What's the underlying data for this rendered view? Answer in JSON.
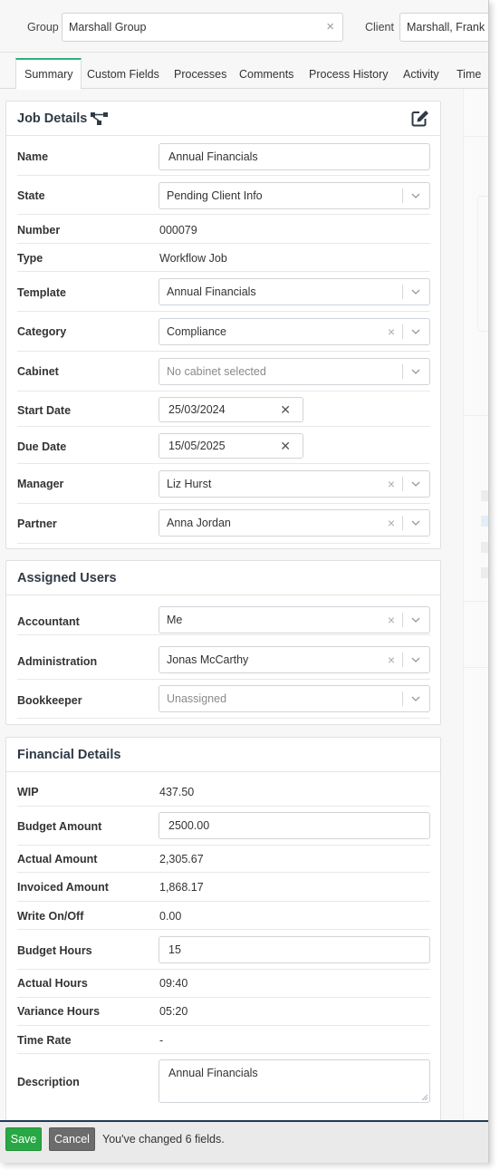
{
  "topbar": {
    "group_label": "Group",
    "group_value": "Marshall Group",
    "client_label": "Client",
    "client_value": "Marshall, Frank"
  },
  "tabs": [
    {
      "label": "Summary",
      "active": true
    },
    {
      "label": "Custom Fields"
    },
    {
      "label": "Processes"
    },
    {
      "label": "Comments"
    },
    {
      "label": "Process History"
    },
    {
      "label": "Activity"
    },
    {
      "label": "Time"
    }
  ],
  "job_details": {
    "title": "Job Details",
    "name_label": "Name",
    "name_value": "Annual Financials",
    "state_label": "State",
    "state_value": "Pending Client Info",
    "number_label": "Number",
    "number_value": "000079",
    "type_label": "Type",
    "type_value": "Workflow Job",
    "template_label": "Template",
    "template_value": "Annual Financials",
    "category_label": "Category",
    "category_value": "Compliance",
    "cabinet_label": "Cabinet",
    "cabinet_placeholder": "No cabinet selected",
    "start_date_label": "Start Date",
    "start_date_value": "25/03/2024",
    "due_date_label": "Due Date",
    "due_date_value": "15/05/2025",
    "manager_label": "Manager",
    "manager_value": "Liz Hurst",
    "partner_label": "Partner",
    "partner_value": "Anna Jordan"
  },
  "assigned_users": {
    "title": "Assigned Users",
    "accountant_label": "Accountant",
    "accountant_value": "Me",
    "administration_label": "Administration",
    "administration_value": "Jonas McCarthy",
    "bookkeeper_label": "Bookkeeper",
    "bookkeeper_placeholder": "Unassigned"
  },
  "financial_details": {
    "title": "Financial Details",
    "wip_label": "WIP",
    "wip_value": "437.50",
    "budget_amount_label": "Budget Amount",
    "budget_amount_value": "2500.00",
    "actual_amount_label": "Actual Amount",
    "actual_amount_value": "2,305.67",
    "invoiced_amount_label": "Invoiced Amount",
    "invoiced_amount_value": "1,868.17",
    "write_onoff_label": "Write On/Off",
    "write_onoff_value": "0.00",
    "budget_hours_label": "Budget Hours",
    "budget_hours_value": "15",
    "actual_hours_label": "Actual Hours",
    "actual_hours_value": "09:40",
    "variance_hours_label": "Variance Hours",
    "variance_hours_value": "05:20",
    "time_rate_label": "Time Rate",
    "time_rate_value": "-",
    "description_label": "Description",
    "description_value": "Annual Financials"
  },
  "footer": {
    "save_label": "Save",
    "cancel_label": "Cancel",
    "changed_message": "You've changed 6 fields."
  },
  "colors": {
    "accent": "#2ab27b",
    "save": "#28a745",
    "cancel": "#6c6c6c",
    "footer_border": "#1f3b57",
    "heading": "#2f3a45"
  },
  "icons": [
    "clear-x-icon",
    "workflow-icon",
    "edit-icon",
    "chevron-down-icon",
    "resize-handle-icon"
  ]
}
